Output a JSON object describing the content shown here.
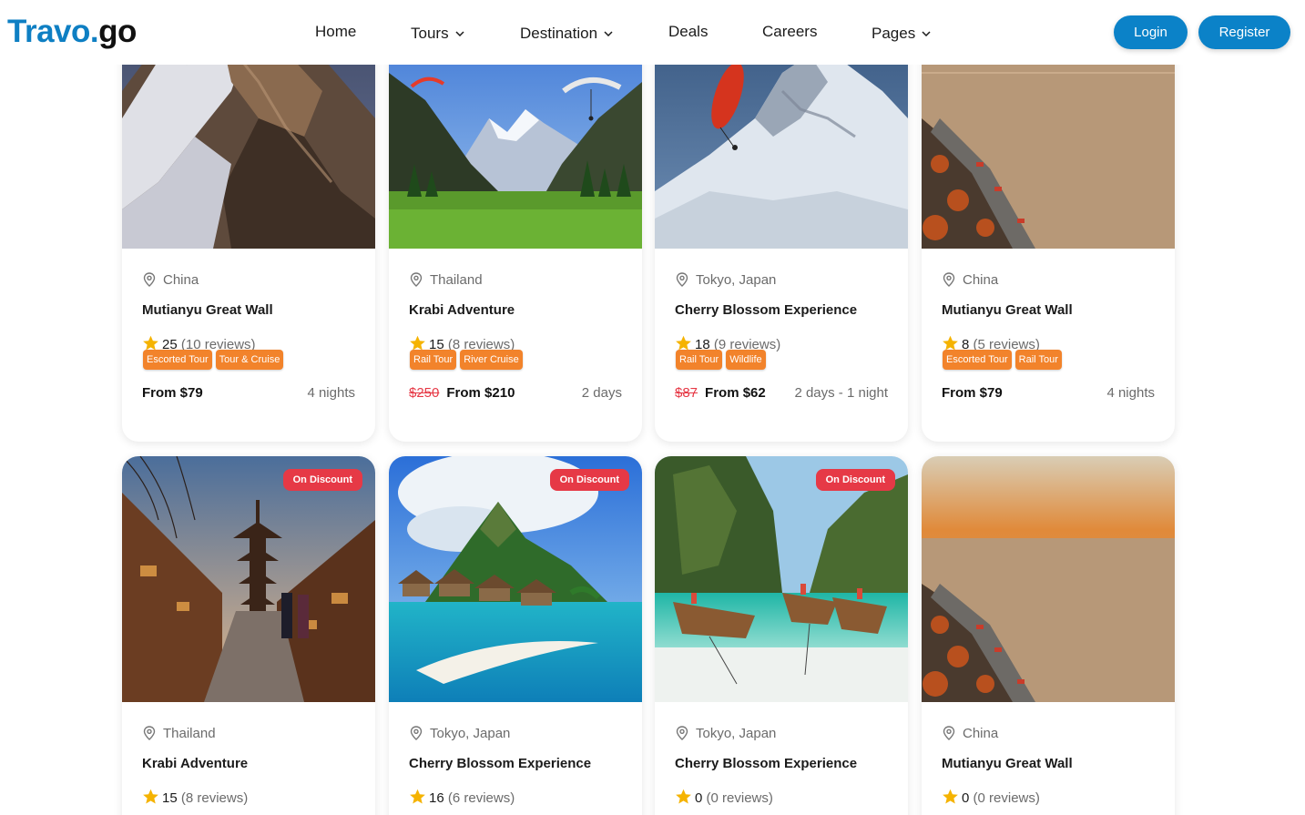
{
  "brand": {
    "part1": "Travo",
    "part2": ".",
    "part3": "go"
  },
  "nav": {
    "home": "Home",
    "tours": "Tours",
    "destination": "Destination",
    "deals": "Deals",
    "careers": "Careers",
    "pages": "Pages"
  },
  "auth": {
    "login": "Login",
    "register": "Register"
  },
  "colors": {
    "primary": "#0b82c8",
    "tag": "#f2832b",
    "discount": "#e63946",
    "star": "#f5b301"
  },
  "icons": {
    "location": "location-pin-icon",
    "star": "star-icon",
    "chevron": "chevron-down-icon"
  },
  "row1": [
    {
      "location": "China",
      "title": "Mutianyu Great Wall",
      "rating": "25",
      "reviews": "(10 reviews)",
      "tags": [
        "Escorted Tour",
        "Tour & Cruise"
      ],
      "old_price": "",
      "price": "From $79",
      "duration": "4 nights"
    },
    {
      "location": "Thailand",
      "title": "Krabi Adventure",
      "rating": "15",
      "reviews": "(8 reviews)",
      "tags": [
        "Rail Tour",
        "River Cruise"
      ],
      "old_price": "$250",
      "price": "From $210",
      "duration": "2 days"
    },
    {
      "location": "Tokyo, Japan",
      "title": "Cherry Blossom Experience",
      "rating": "18",
      "reviews": "(9 reviews)",
      "tags": [
        "Rail Tour",
        "Wildlife"
      ],
      "old_price": "$87",
      "price": "From $62",
      "duration": "2 days - 1 night"
    },
    {
      "location": "China",
      "title": "Mutianyu Great Wall",
      "rating": "8",
      "reviews": "(5 reviews)",
      "tags": [
        "Escorted Tour",
        "Rail Tour"
      ],
      "old_price": "",
      "price": "From $79",
      "duration": "4 nights"
    }
  ],
  "row2": [
    {
      "badge": "On Discount",
      "location": "Thailand",
      "title": "Krabi Adventure",
      "rating": "15",
      "reviews": "(8 reviews)"
    },
    {
      "badge": "On Discount",
      "location": "Tokyo, Japan",
      "title": "Cherry Blossom Experience",
      "rating": "16",
      "reviews": "(6 reviews)"
    },
    {
      "badge": "On Discount",
      "location": "Tokyo, Japan",
      "title": "Cherry Blossom Experience",
      "rating": "0",
      "reviews": "(0 reviews)"
    },
    {
      "badge": "",
      "location": "China",
      "title": "Mutianyu Great Wall",
      "rating": "0",
      "reviews": "(0 reviews)"
    }
  ]
}
